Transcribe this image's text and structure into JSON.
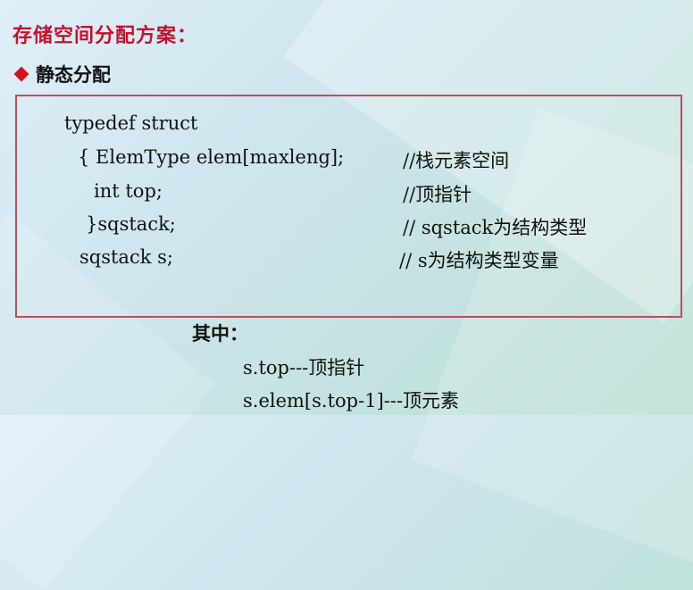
{
  "slide": {
    "title": "存储空间分配方案：",
    "bullet": "静态分配",
    "code": [
      {
        "code": "typedef struct",
        "comment": ""
      },
      {
        "code": "{ ElemType elem[maxleng];",
        "comment": "//栈元素空间"
      },
      {
        "code": "int top;",
        "comment": "//顶指针"
      },
      {
        "code": "}sqstack;",
        "comment": "// sqstack为结构类型"
      },
      {
        "code": "sqstack s;",
        "comment": "// s为结构类型变量"
      }
    ],
    "notes_heading": "其中：",
    "notes": [
      "s.top---顶指针",
      "s.elem[s.top-1]---顶元素"
    ]
  },
  "colors": {
    "title": "#c8102e",
    "bullet": "#d4111e",
    "box_border": "#c24a5e"
  }
}
